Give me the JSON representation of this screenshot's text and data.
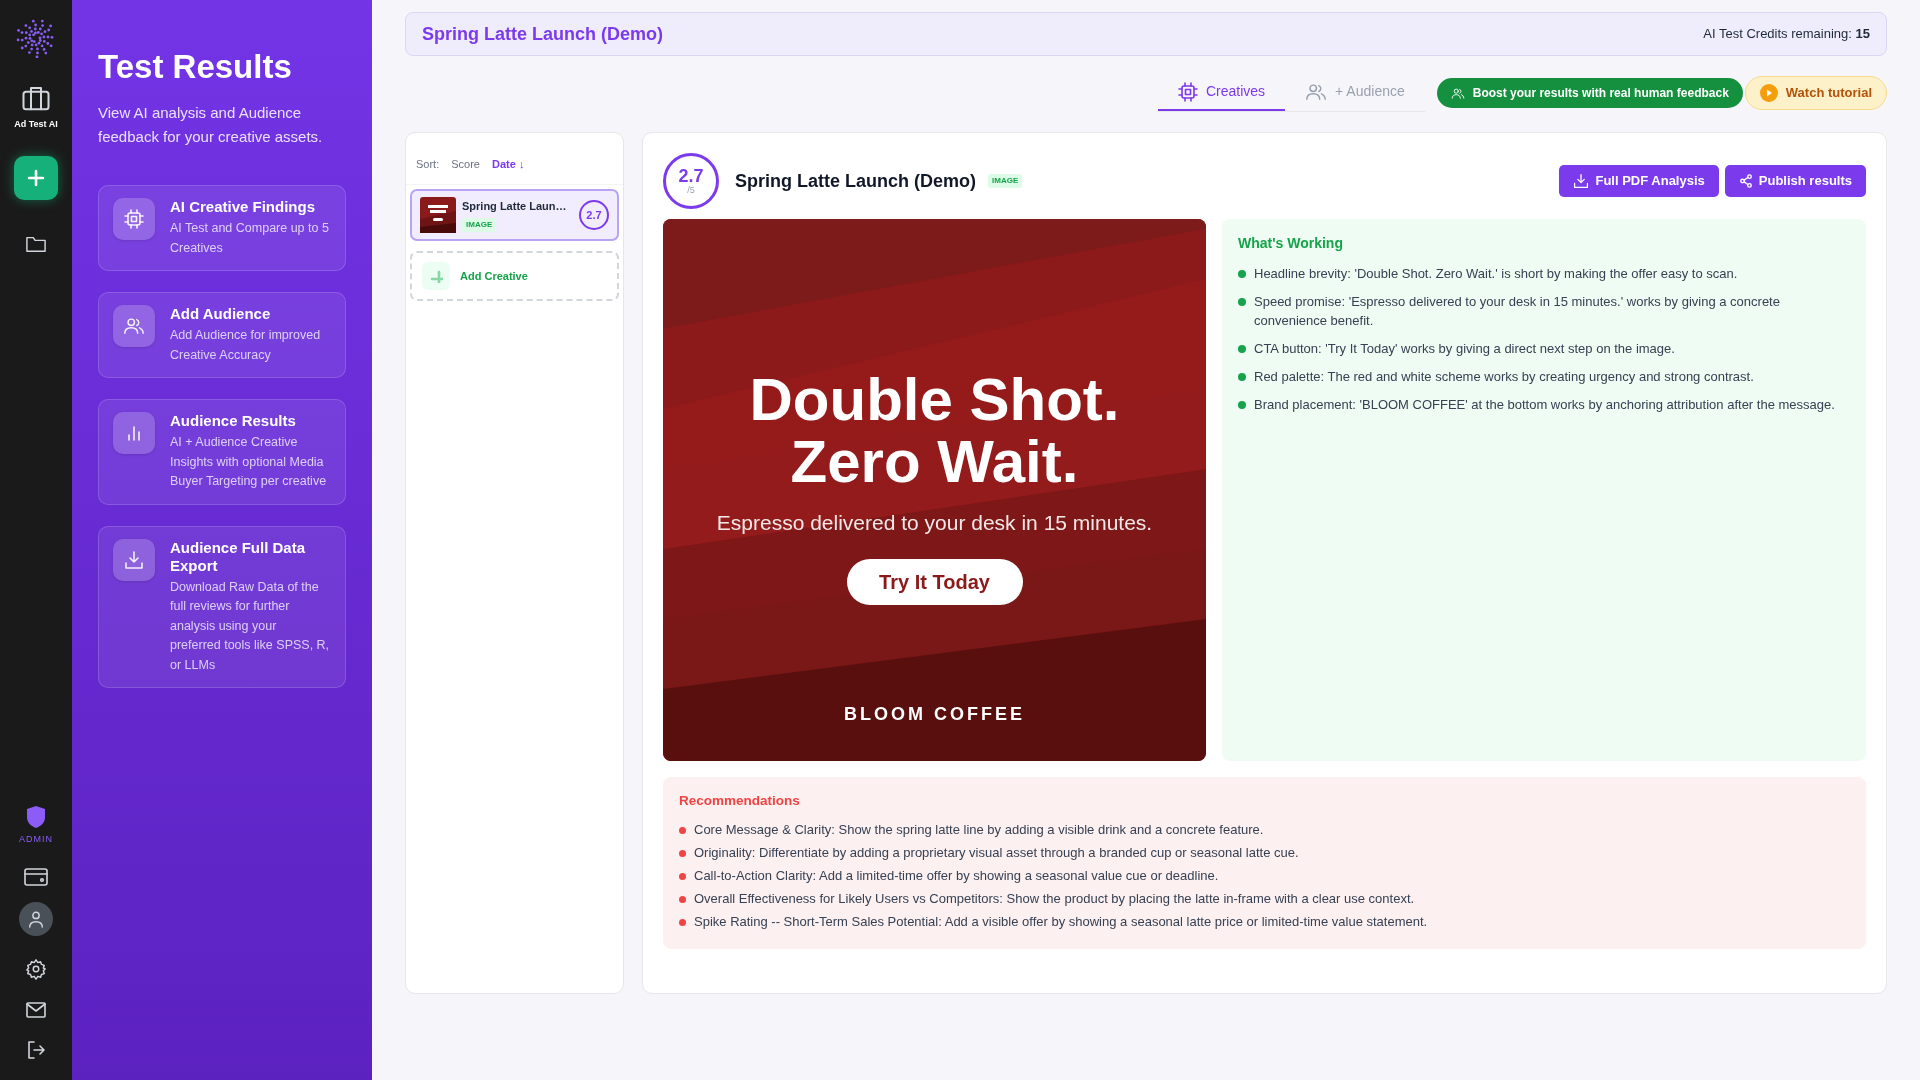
{
  "rail": {
    "brand_label": "Ad Test AI",
    "admin_label": "ADMIN"
  },
  "sidebar": {
    "title": "Test Results",
    "subtitle": "View AI analysis and Audience feedback for your creative assets.",
    "cards": [
      {
        "title": "AI Creative Findings",
        "description": "AI Test and Compare up to 5 Creatives"
      },
      {
        "title": "Add Audience",
        "description": "Add Audience for improved Creative Accuracy"
      },
      {
        "title": "Audience Results",
        "description": "AI + Audience Creative Insights with optional Media Buyer Targeting per creative"
      },
      {
        "title": "Audience Full Data Export",
        "description": "Download Raw Data of the full reviews for further analysis using your preferred tools like SPSS, R, or LLMs"
      }
    ]
  },
  "header": {
    "project_title": "Spring Latte Launch (Demo)",
    "credits_label": "AI Test Credits remaining:",
    "credits_value": "15"
  },
  "tabs": [
    {
      "label": "Creatives",
      "selected": true
    },
    {
      "label": "+ Audience",
      "selected": false
    }
  ],
  "boost_button": "Boost your results with real human feedback",
  "tutorial_button": "Watch tutorial",
  "list": {
    "sort_label": "Sort:",
    "sort_options": [
      {
        "label": "Score",
        "selected": false
      },
      {
        "label": "Date ↓",
        "selected": true
      }
    ],
    "creatives": [
      {
        "name": "Spring Latte Laun…",
        "badge": "IMAGE",
        "score": "2.7",
        "selected": true
      }
    ],
    "add_label": "Add Creative"
  },
  "detail": {
    "score": "2.7",
    "score_max": "/5",
    "title": "Spring Latte Launch (Demo)",
    "badge": "IMAGE",
    "actions": [
      "Full PDF Analysis",
      "Publish results"
    ],
    "creative": {
      "headline_lines": [
        "Double Shot.",
        "Zero Wait."
      ],
      "subline": "Espresso delivered to your desk in 15 minutes.",
      "cta": "Try It Today",
      "brand": "BLOOM COFFEE"
    },
    "working": {
      "title": "What's Working",
      "items": [
        "Headline brevity: 'Double Shot. Zero Wait.' is short by making the offer easy to scan.",
        "Speed promise: 'Espresso delivered to your desk in 15 minutes.' works by giving a concrete convenience benefit.",
        "CTA button: 'Try It Today' works by giving a direct next step on the image.",
        "Red palette: The red and white scheme works by creating urgency and strong contrast.",
        "Brand placement: 'BLOOM COFFEE' at the bottom works by anchoring attribution after the message."
      ]
    },
    "recommendations": {
      "title": "Recommendations",
      "items": [
        "Core Message & Clarity: Show the spring latte line by adding a visible drink and a concrete feature.",
        "Originality: Differentiate by adding a proprietary visual asset through a branded cup or seasonal latte cue.",
        "Call-to-Action Clarity: Add a limited-time offer by showing a seasonal value cue or deadline.",
        "Overall Effectiveness for Likely Users vs Competitors: Show the product by placing the latte in-frame with a clear use context.",
        "Spike Rating -- Short-Term Sales Potential: Add a visible offer by showing a seasonal latte price or limited-time value statement."
      ]
    }
  }
}
